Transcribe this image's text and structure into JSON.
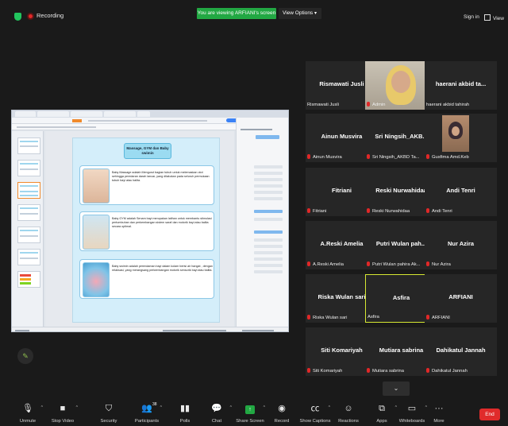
{
  "topbar": {
    "recording_label": "Recording",
    "viewing_banner": "You are viewing ARFIANI's screen",
    "view_options_label": "View Options",
    "signin_label": "Sign in",
    "view_label": "View"
  },
  "slide": {
    "title": "Massage, GYM dan Baby swimin",
    "cards": [
      {
        "text": "Baby Massage adalah Mengurut bagian tubuh untuk melemaskan otot sehingga peredaran darah lancar, yang dilakukan pada seluruh permukaan tubuh bayi atau balita."
      },
      {
        "text": "Baby GYM adalah Senam bayi merupakan latihan untuk membantu stimulasi pertumbuhan dan perkembangan sistem saraf dan motorik bayi atau balita secara optimal."
      },
      {
        "text": "Baby swimin adalah perendaman bayi dalam kolam berisi air hangat , dengan relaksasi, yang merangsang perkembangan motorik sensorik bayi atau balita."
      }
    ]
  },
  "participants": [
    {
      "name": "Rismawati Jusli",
      "footer": "Rismawati Jusli",
      "muted": false,
      "video": false
    },
    {
      "name": "",
      "footer": "Admin",
      "muted": true,
      "video": true
    },
    {
      "name": "haerani akbid ta...",
      "footer": "haerani akbid tahirah",
      "muted": false,
      "video": false
    },
    {
      "name": "Ainun Musvira",
      "footer": "Ainun Musvira",
      "muted": true,
      "video": false
    },
    {
      "name": "Sri Ningsih_AKB...",
      "footer": "Sri Ningsih_AKBD Ta...",
      "muted": true,
      "video": false
    },
    {
      "name": "",
      "footer": "Gusfima Amd.Keb",
      "muted": true,
      "video": true
    },
    {
      "name": "Fitriani",
      "footer": "Fitriani",
      "muted": true,
      "video": false
    },
    {
      "name": "Reski Nurwahidaa",
      "footer": "Reski Nurwahidaa",
      "muted": true,
      "video": false
    },
    {
      "name": "Andi Tenri",
      "footer": "Andi Tenri",
      "muted": true,
      "video": false
    },
    {
      "name": "A.Reski Amelia",
      "footer": "A.Reski Amelia",
      "muted": true,
      "video": false
    },
    {
      "name": "Putri Wulan pah...",
      "footer": "Putri Wulan pahira Ak...",
      "muted": true,
      "video": false
    },
    {
      "name": "Nur Azira",
      "footer": "Nur Azira",
      "muted": true,
      "video": false
    },
    {
      "name": "Riska Wulan sari",
      "footer": "Riska Wulan sari",
      "muted": true,
      "video": false
    },
    {
      "name": "Asfira",
      "footer": "Asfira",
      "muted": false,
      "video": false,
      "active": true
    },
    {
      "name": "ARFIANI",
      "footer": "ARFIANI",
      "muted": true,
      "video": false
    },
    {
      "name": "Siti Komariyah",
      "footer": "Siti Komariyah",
      "muted": true,
      "video": false
    },
    {
      "name": "Mutiara sabrina",
      "footer": "Mutiara sabrina",
      "muted": true,
      "video": false
    },
    {
      "name": "Dahikatul Jannah",
      "footer": "Dahikatul Jannah",
      "muted": true,
      "video": false
    }
  ],
  "toolbar": {
    "items": [
      {
        "label": "Unmute",
        "icon": "microphone-muted-icon"
      },
      {
        "label": "Stop Video",
        "icon": "video-camera-icon"
      },
      {
        "label": "Security",
        "icon": "shield-icon"
      },
      {
        "label": "Participants",
        "icon": "participants-icon",
        "count": "38"
      },
      {
        "label": "Polls",
        "icon": "polls-icon"
      },
      {
        "label": "Chat",
        "icon": "chat-icon"
      },
      {
        "label": "Share Screen",
        "icon": "share-screen-icon"
      },
      {
        "label": "Record",
        "icon": "record-icon"
      },
      {
        "label": "Show Captions",
        "icon": "captions-icon"
      },
      {
        "label": "Reactions",
        "icon": "reactions-icon"
      },
      {
        "label": "Apps",
        "icon": "apps-icon"
      },
      {
        "label": "Whiteboards",
        "icon": "whiteboard-icon"
      },
      {
        "label": "More",
        "icon": "more-icon"
      }
    ],
    "end_label": "End"
  }
}
